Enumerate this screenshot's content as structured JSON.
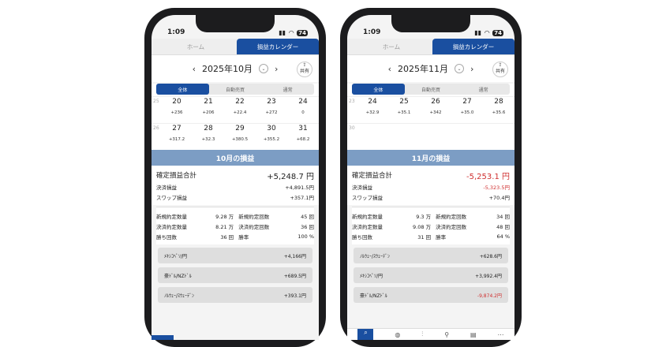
{
  "phones": [
    {
      "status": {
        "time": "1:09",
        "battery": "74"
      },
      "tabs": [
        "ホーム",
        "損益カレンダー"
      ],
      "month": "2025年10月",
      "share_label": "共有",
      "segments": [
        "全体",
        "自動売買",
        "通常"
      ],
      "weeks": [
        {
          "num": "25",
          "days": [
            {
              "d": "20",
              "v": "+236"
            },
            {
              "d": "21",
              "v": "+206"
            },
            {
              "d": "22",
              "v": "+22.4"
            },
            {
              "d": "23",
              "v": "+272"
            },
            {
              "d": "24",
              "v": "0"
            }
          ]
        },
        {
          "num": "26",
          "days": [
            {
              "d": "27",
              "v": "+317.2"
            },
            {
              "d": "28",
              "v": "+32.3"
            },
            {
              "d": "29",
              "v": "+380.5"
            },
            {
              "d": "30",
              "v": "+355.2"
            },
            {
              "d": "31",
              "v": "+68.2"
            }
          ]
        }
      ],
      "banner": "10月の損益",
      "summary": {
        "total_label": "確定損益合計",
        "total": "+5,248.7 円",
        "settle_label": "決済損益",
        "settle": "+4,891.5円",
        "swap_label": "スワップ損益",
        "swap": "+357.1円"
      },
      "stats": [
        [
          "新規約定数量",
          "9.28 万",
          "新規約定回数",
          "45 回"
        ],
        [
          "決済約定数量",
          "8.21 万",
          "決済約定回数",
          "36 回"
        ],
        [
          "勝ち回数",
          "36 回",
          "勝率",
          "100 %"
        ]
      ],
      "pairs": [
        {
          "name": "ﾒｷｼｺﾍﾟｿ/円",
          "value": "+4,166円",
          "neg": false
        },
        {
          "name": "豪ﾄﾞﾙ/NZﾄﾞﾙ",
          "value": "+689.5円",
          "neg": false
        },
        {
          "name": "ﾉﾙｳｪｰ/ｽｳｪｰﾃﾞﾝ",
          "value": "+393.1円",
          "neg": false
        }
      ]
    },
    {
      "status": {
        "time": "1:09",
        "battery": "74"
      },
      "tabs": [
        "ホーム",
        "損益カレンダー"
      ],
      "month": "2025年11月",
      "share_label": "共有",
      "segments": [
        "全体",
        "自動売買",
        "通常"
      ],
      "weeks": [
        {
          "num": "23",
          "days": [
            {
              "d": "24",
              "v": "+32.9"
            },
            {
              "d": "25",
              "v": "+35.1"
            },
            {
              "d": "26",
              "v": "+342"
            },
            {
              "d": "27",
              "v": "+35.0"
            },
            {
              "d": "28",
              "v": "+35.6"
            }
          ]
        },
        {
          "num": "30",
          "days": [
            {
              "d": "",
              "v": ""
            },
            {
              "d": "",
              "v": ""
            },
            {
              "d": "",
              "v": ""
            },
            {
              "d": "",
              "v": ""
            },
            {
              "d": "",
              "v": ""
            }
          ]
        }
      ],
      "banner": "11月の損益",
      "summary": {
        "total_label": "確定損益合計",
        "total": "-5,253.1 円",
        "settle_label": "決済損益",
        "settle": "-5,323.5円",
        "swap_label": "スワップ損益",
        "swap": "+70.4円"
      },
      "stats": [
        [
          "新規約定数量",
          "9.3 万",
          "新規約定回数",
          "34 回"
        ],
        [
          "決済約定数量",
          "9.08 万",
          "決済約定回数",
          "48 回"
        ],
        [
          "勝ち回数",
          "31 回",
          "勝率",
          "64 %"
        ]
      ],
      "pairs": [
        {
          "name": "ﾉﾙｳｪｰ/ｽｳｪｰﾃﾞﾝ",
          "value": "+628.6円",
          "neg": false
        },
        {
          "name": "ﾒｷｼｺﾍﾟｿ/円",
          "value": "+3,992.4円",
          "neg": false
        },
        {
          "name": "豪ﾄﾞﾙ/NZﾄﾞﾙ",
          "value": "-9,874.2円",
          "neg": true
        }
      ],
      "bottom_nav": [
        "search-icon",
        "globe-icon",
        "chart-icon",
        "filter-icon",
        "list-icon",
        "more-icon"
      ]
    }
  ]
}
